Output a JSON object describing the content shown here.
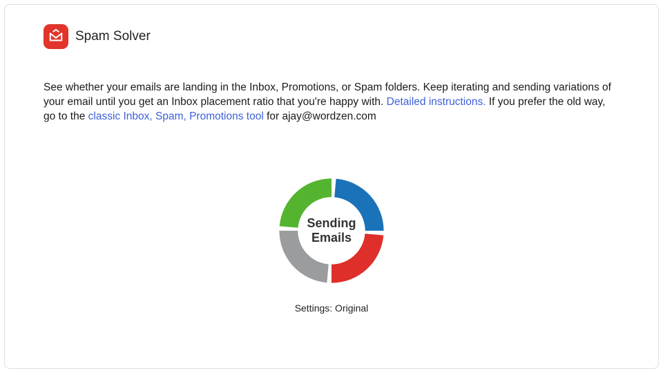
{
  "title": "Spam Solver",
  "intro": {
    "text_1": "See whether your emails are landing in the Inbox, Promotions, or Spam folders. Keep iterating and sending variations of your email until you get an Inbox placement ratio that you're happy with. ",
    "link_detailed": "Detailed instructions.",
    "text_2": " If you prefer the old way, go to the ",
    "link_classic": "classic Inbox, Spam, Promotions tool",
    "text_3": " for ajay@wordzen.com"
  },
  "spinner": {
    "center_label": "Sending Emails",
    "settings_label": "Settings: Original"
  },
  "chart_data": {
    "type": "pie",
    "title": "Sending Emails",
    "series": [
      {
        "name": "blue",
        "value": 25,
        "color": "#1a72b8"
      },
      {
        "name": "red",
        "value": 25,
        "color": "#de2f2b"
      },
      {
        "name": "gray",
        "value": 25,
        "color": "#9b9c9d"
      },
      {
        "name": "green",
        "value": 25,
        "color": "#54b42f"
      }
    ]
  }
}
